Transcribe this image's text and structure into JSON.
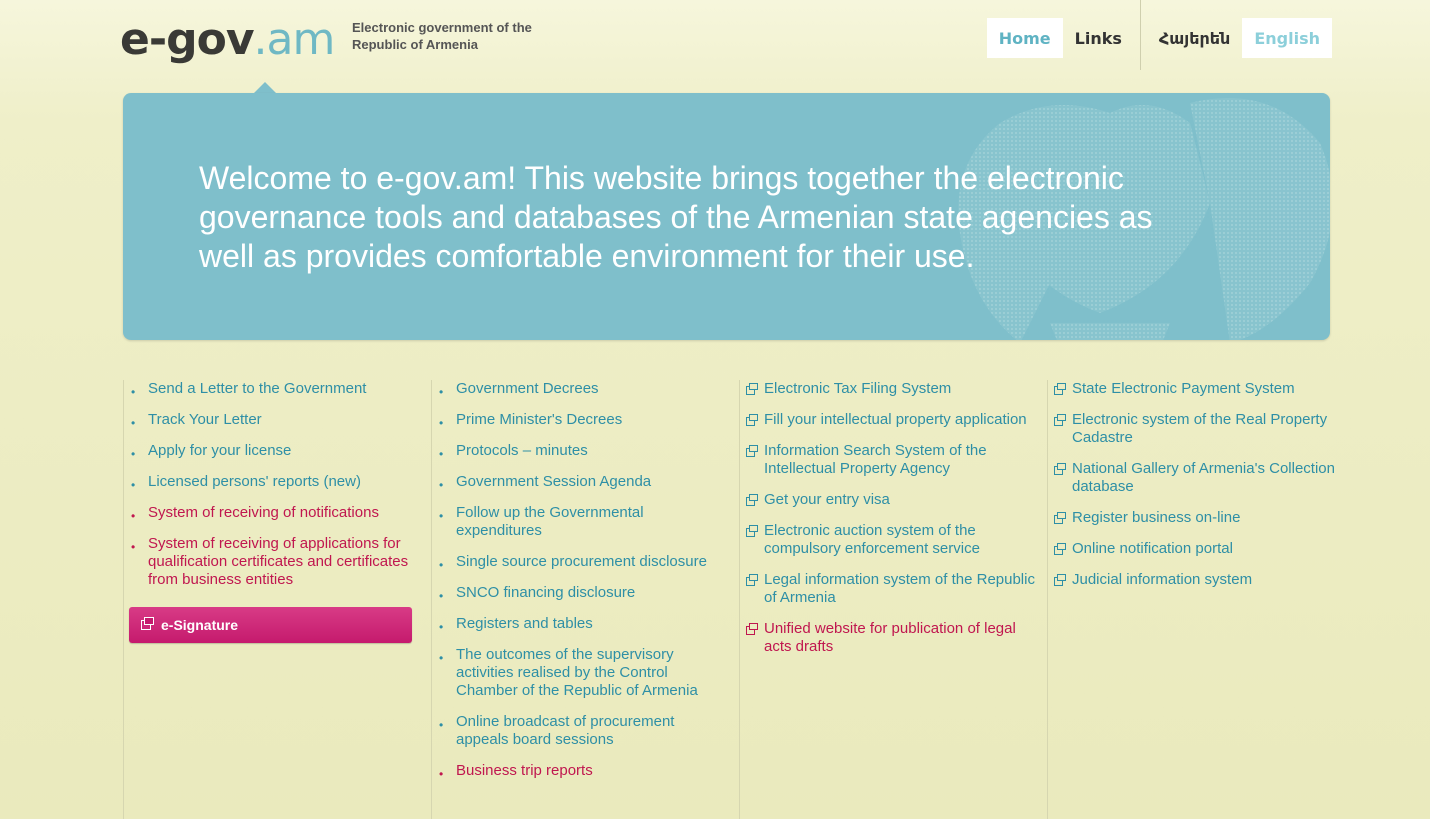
{
  "header": {
    "logo_bold": "e-gov",
    "logo_thin": ".am",
    "tagline": "Electronic government of the Republic of Armenia",
    "nav": {
      "home": "Home",
      "links": "Links",
      "armenian": "Հայերեն",
      "english": "English"
    }
  },
  "banner": {
    "text": "Welcome to e-gov.am! This website brings together the electronic governance tools and databases of the Armenian state agencies as well as provides comfortable environment for their use."
  },
  "col1": {
    "items": [
      "Send a Letter to the Government",
      "Track Your Letter",
      "Apply for your license",
      "Licensed persons' reports (new)",
      "System of receiving of notifications",
      "System of receiving of applications for qualification certificates and certificates from business entities"
    ],
    "button": "e-Signature"
  },
  "col2": {
    "items": [
      "Government Decrees",
      "Prime Minister's Decrees",
      "Protocols – minutes",
      "Government Session Agenda",
      "Follow up the Governmental expenditures",
      "Single source procurement disclosure",
      "SNCO financing disclosure",
      "Registers and tables",
      "The outcomes of the supervisory activities realised by the Control Chamber of the Republic of Armenia",
      "Online broadcast of procurement appeals board sessions",
      "Business trip reports"
    ]
  },
  "col3": {
    "items": [
      "Electronic Tax Filing System",
      "Fill your intellectual property application",
      "Information Search System of the Intellectual Property Agency",
      "Get your entry visa",
      "Electronic auction system of the compulsory enforcement service",
      "Legal information system of the Republic of Armenia",
      "Unified website for publication of legal acts drafts"
    ]
  },
  "col4": {
    "items": [
      "State Electronic Payment System",
      "Electronic system of the Real Property Cadastre",
      "National Gallery of Armenia's Collection database",
      "Register business on-line",
      "Online notification portal",
      "Judicial information system"
    ]
  },
  "colors": {
    "link_blue": "#2e8fa6",
    "link_red": "#c0174f",
    "banner": "#7fbfcb",
    "esig": "#c51a6d"
  }
}
